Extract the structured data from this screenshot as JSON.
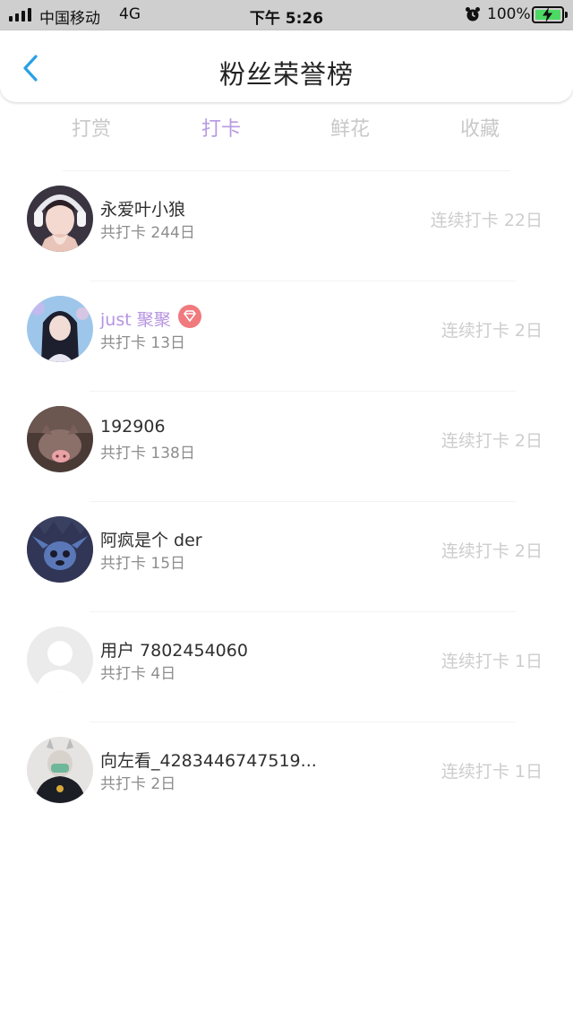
{
  "status_bar": {
    "carrier": "中国移动",
    "network": "4G",
    "time": "下午 5:26",
    "battery": "100%"
  },
  "header": {
    "title": "粉丝荣誉榜",
    "back_icon": "chevron-left-icon",
    "accent_color": "#2aa0e6"
  },
  "tabs": [
    {
      "label": "打赏",
      "active": false
    },
    {
      "label": "打卡",
      "active": true
    },
    {
      "label": "鲜花",
      "active": false
    },
    {
      "label": "收藏",
      "active": false
    }
  ],
  "active_tab_color": "#b79ae3",
  "fans": [
    {
      "name": "永爱叶小狼",
      "total": "共打卡 244日",
      "streak": "连续打卡 22日",
      "vip": false,
      "avatar": "photo-girl-headphones"
    },
    {
      "name": "just 聚聚",
      "total": "共打卡 13日",
      "streak": "连续打卡 2日",
      "vip": true,
      "vip_icon": "diamond-badge-icon",
      "avatar": "photo-girl-blue"
    },
    {
      "name": "192906",
      "total": "共打卡 138日",
      "streak": "连续打卡 2日",
      "vip": false,
      "avatar": "photo-pig"
    },
    {
      "name": "阿疯是个 der",
      "total": "共打卡 15日",
      "streak": "连续打卡 2日",
      "vip": false,
      "avatar": "photo-stitch"
    },
    {
      "name": "用户 7802454060",
      "total": "共打卡 4日",
      "streak": "连续打卡 1日",
      "vip": false,
      "avatar": "default-user-icon"
    },
    {
      "name": "向左看_4283446747519...",
      "total": "共打卡 2日",
      "streak": "连续打卡 1日",
      "vip": false,
      "avatar": "photo-masked-person"
    }
  ]
}
